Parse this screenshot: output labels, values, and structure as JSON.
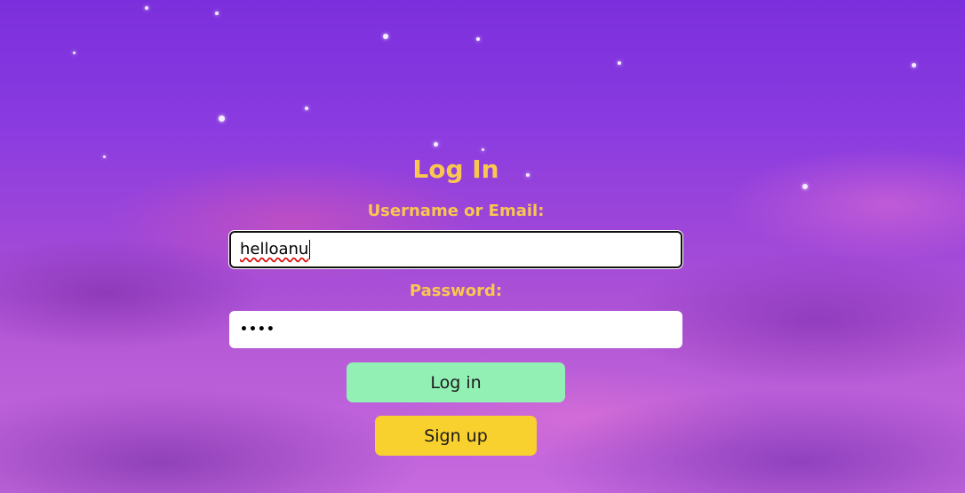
{
  "login": {
    "title": "Log In",
    "username_label": "Username or Email:",
    "username_value": "helloanu",
    "password_label": "Password:",
    "password_mask": "••••",
    "login_button": "Log in",
    "signup_button": "Sign up"
  },
  "colors": {
    "heading": "#f9c74f",
    "login_button": "#93f0b4",
    "signup_button": "#f8d12e",
    "background_top": "#7b2fdc",
    "background_bottom": "#c76adf"
  }
}
